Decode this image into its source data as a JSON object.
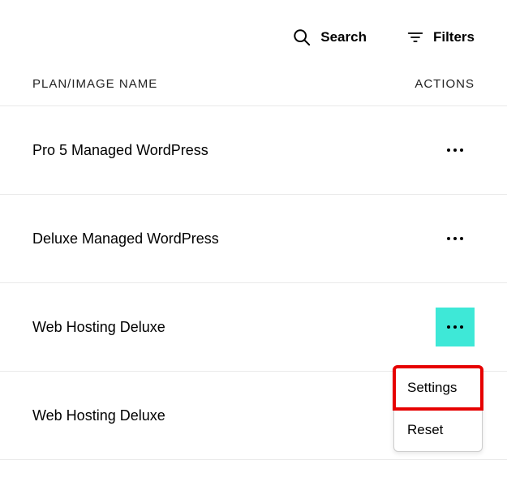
{
  "toolbar": {
    "search_label": "Search",
    "filters_label": "Filters"
  },
  "table": {
    "header_plan": "PLAN/IMAGE NAME",
    "header_actions": "ACTIONS",
    "rows": [
      {
        "name": "Pro 5 Managed WordPress"
      },
      {
        "name": "Deluxe Managed WordPress"
      },
      {
        "name": "Web Hosting Deluxe"
      },
      {
        "name": "Web Hosting Deluxe"
      }
    ]
  },
  "dropdown": {
    "settings_label": "Settings",
    "reset_label": "Reset"
  }
}
